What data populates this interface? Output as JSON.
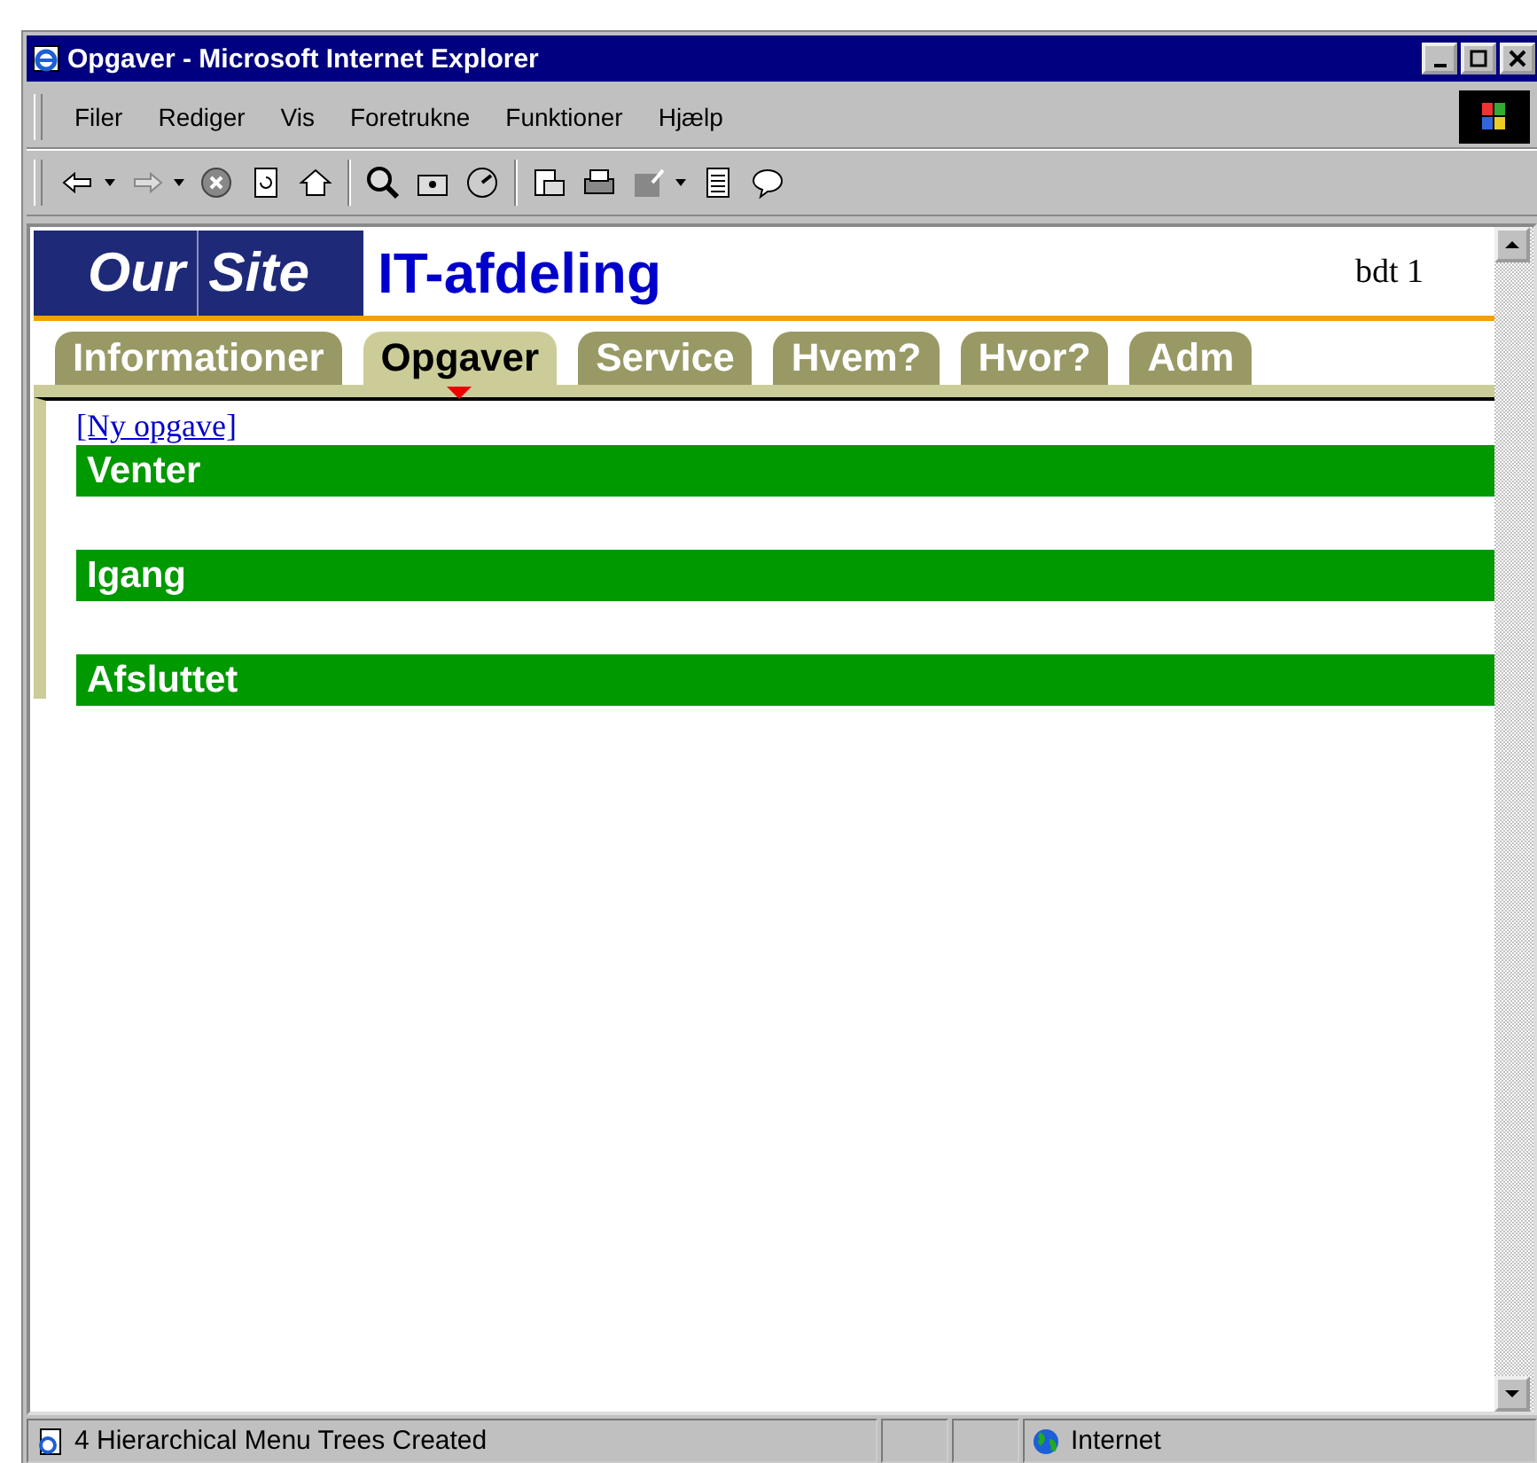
{
  "window": {
    "title": "Opgaver - Microsoft Internet Explorer"
  },
  "menu": [
    "Filer",
    "Rediger",
    "Vis",
    "Foretrukne",
    "Funktioner",
    "Hjælp"
  ],
  "page": {
    "logo": [
      "Our",
      "Site"
    ],
    "heading": "IT-afdeling",
    "user": "bdt 1",
    "tabs": [
      {
        "label": "Informationer",
        "selected": false
      },
      {
        "label": "Opgaver",
        "selected": true
      },
      {
        "label": "Service",
        "selected": false
      },
      {
        "label": "Hvem?",
        "selected": false
      },
      {
        "label": "Hvor?",
        "selected": false
      },
      {
        "label": "Adm",
        "selected": false
      }
    ],
    "link": "[Ny opgave]",
    "sections": [
      "Venter",
      "Igang",
      "Afsluttet"
    ]
  },
  "status_bar": {
    "message": "4 Hierarchical Menu Trees Created",
    "zone": "Internet"
  }
}
